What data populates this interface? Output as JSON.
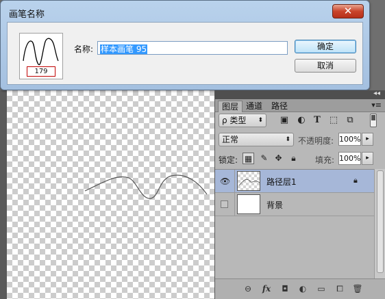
{
  "dialog": {
    "title": "画笔名称",
    "close_label": "✕",
    "preview_size": "179",
    "name_label": "名称:",
    "name_value": "样本画笔 95",
    "ok_label": "确定",
    "cancel_label": "取消"
  },
  "panel": {
    "tabs": [
      {
        "label": "图层",
        "active": true
      },
      {
        "label": "通道",
        "active": false
      },
      {
        "label": "路径",
        "active": false
      }
    ],
    "menu_icon": "panel-menu-icon",
    "filter": {
      "label": "ρ 类型"
    },
    "filter_icons": [
      "image-filter-icon",
      "adjustment-filter-icon",
      "type-filter-icon",
      "shape-filter-icon",
      "smart-object-filter-icon"
    ],
    "blend_mode": "正常",
    "opacity_label": "不透明度:",
    "opacity_value": "100%",
    "lock_label": "锁定:",
    "lock_icons": [
      "lock-transparent-icon",
      "lock-paint-icon",
      "lock-move-icon",
      "lock-all-icon"
    ],
    "fill_label": "填充:",
    "fill_value": "100%",
    "layers": [
      {
        "name": "路径层1",
        "visible": true,
        "selected": true,
        "locked": true
      },
      {
        "name": "背景",
        "visible": false,
        "selected": false,
        "locked": false
      }
    ],
    "bottom_icons": [
      "link-icon",
      "fx-icon",
      "mask-icon",
      "adjustment-icon",
      "group-folder-icon",
      "new-layer-icon",
      "trash-icon"
    ]
  },
  "colors": {
    "dialog_bg": "#b9d2ec",
    "close_button": "#c9442b",
    "selection": "#3399ff",
    "selected_layer": "#a6b7d8",
    "preview_border": "#c00000"
  }
}
